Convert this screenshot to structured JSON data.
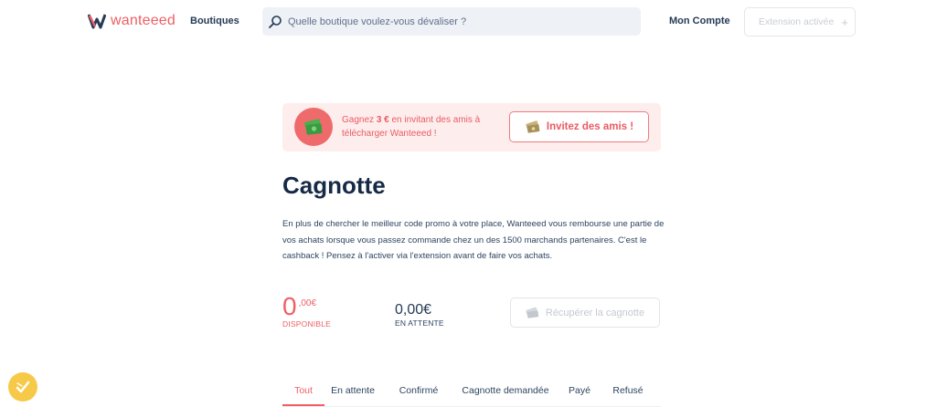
{
  "header": {
    "logo_text": "wanteeed",
    "nav_boutiques": "Boutiques",
    "search_placeholder": "Quelle boutique voulez-vous dévaliser ?",
    "nav_account": "Mon Compte",
    "extension_label": "Extension activée",
    "extension_icon": "plus-icon"
  },
  "banner": {
    "text_before": "Gagnez ",
    "text_amount": "3 €",
    "text_after": " en invitant des amis à télécharger Wanteeed !",
    "invite_label": "Invitez des amis !",
    "badge_icon": "money-stack-icon"
  },
  "cagnotte": {
    "title": "Cagnotte",
    "description": "En plus de chercher le meilleur code promo à votre place, Wanteeed vous rembourse une partie de vos achats lorsque vous passez commande chez un des 1500 marchands partenaires. C'est le cashback ! Pensez à l'activer via l'extension avant de faire vos achats.",
    "available_int": "0",
    "available_dec": ",00€",
    "available_label": "DISPONIBLE",
    "pending_amount": "0,00€",
    "pending_label": "EN ATTENTE",
    "recover_label": "Récupérer la cagnotte"
  },
  "tabs": [
    {
      "label": "Tout",
      "active": true
    },
    {
      "label": "En attente",
      "active": false
    },
    {
      "label": "Confirmé",
      "active": false
    },
    {
      "label": "Cagnotte demandée",
      "active": false
    },
    {
      "label": "Payé",
      "active": false
    },
    {
      "label": "Refusé",
      "active": false
    }
  ],
  "colors": {
    "brand": "#ef5e64",
    "navy": "#162a47",
    "banner_bg": "#fdeeed",
    "fab": "#f7c948"
  }
}
